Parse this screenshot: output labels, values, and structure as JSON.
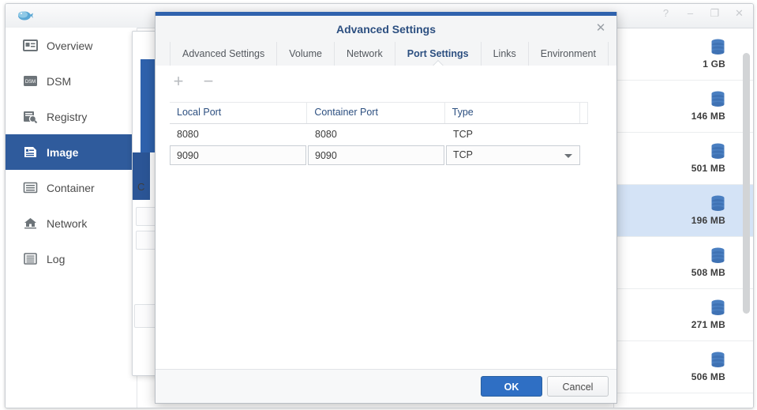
{
  "window": {
    "logo_icon": "docker-whale-icon",
    "controls": [
      {
        "name": "help-button",
        "glyph": "?"
      },
      {
        "name": "minimize-button",
        "glyph": "–"
      },
      {
        "name": "maximize-button",
        "glyph": "❐"
      },
      {
        "name": "close-button",
        "glyph": "✕"
      }
    ]
  },
  "sidebar": {
    "items": [
      {
        "label": "Overview",
        "icon": "overview-icon",
        "selected": false
      },
      {
        "label": "DSM",
        "icon": "dsm-icon",
        "selected": false
      },
      {
        "label": "Registry",
        "icon": "registry-search-icon",
        "selected": false
      },
      {
        "label": "Image",
        "icon": "image-icon",
        "selected": true
      },
      {
        "label": "Container",
        "icon": "container-icon",
        "selected": false
      },
      {
        "label": "Network",
        "icon": "network-home-icon",
        "selected": false
      },
      {
        "label": "Log",
        "icon": "log-icon",
        "selected": false
      }
    ]
  },
  "image_list": {
    "rows": [
      {
        "size": "1 GB",
        "icon": "database-icon",
        "selected": false
      },
      {
        "size": "146 MB",
        "icon": "database-icon",
        "selected": false
      },
      {
        "size": "501 MB",
        "icon": "database-icon",
        "selected": false
      },
      {
        "size": "196 MB",
        "icon": "database-icon",
        "selected": true
      },
      {
        "size": "508 MB",
        "icon": "database-icon",
        "selected": false
      },
      {
        "size": "271 MB",
        "icon": "database-icon",
        "selected": false
      },
      {
        "size": "506 MB",
        "icon": "database-icon",
        "selected": false
      }
    ]
  },
  "background_window": {
    "partial_label": "C"
  },
  "dialog": {
    "title": "Advanced Settings",
    "close_glyph": "✕",
    "tabs": [
      {
        "label": "Advanced Settings",
        "active": false
      },
      {
        "label": "Volume",
        "active": false
      },
      {
        "label": "Network",
        "active": false
      },
      {
        "label": "Port Settings",
        "active": true
      },
      {
        "label": "Links",
        "active": false
      },
      {
        "label": "Environment",
        "active": false
      }
    ],
    "toolbar": {
      "add_glyph": "+",
      "remove_glyph": "−"
    },
    "port_table": {
      "columns": [
        "Local Port",
        "Container Port",
        "Type"
      ],
      "rows": [
        {
          "local_port": "8080",
          "container_port": "8080",
          "type": "TCP",
          "editing": false
        },
        {
          "local_port": "9090",
          "container_port": "9090",
          "type": "TCP",
          "editing": true
        }
      ]
    },
    "footer": {
      "ok_label": "OK",
      "cancel_label": "Cancel"
    }
  },
  "colors": {
    "accent_blue": "#2f62ad",
    "button_blue": "#2f6fc4",
    "selected_sidebar": "#2f5b9c",
    "selected_row": "#d4e3f6",
    "title_blue": "#2c4f80"
  }
}
